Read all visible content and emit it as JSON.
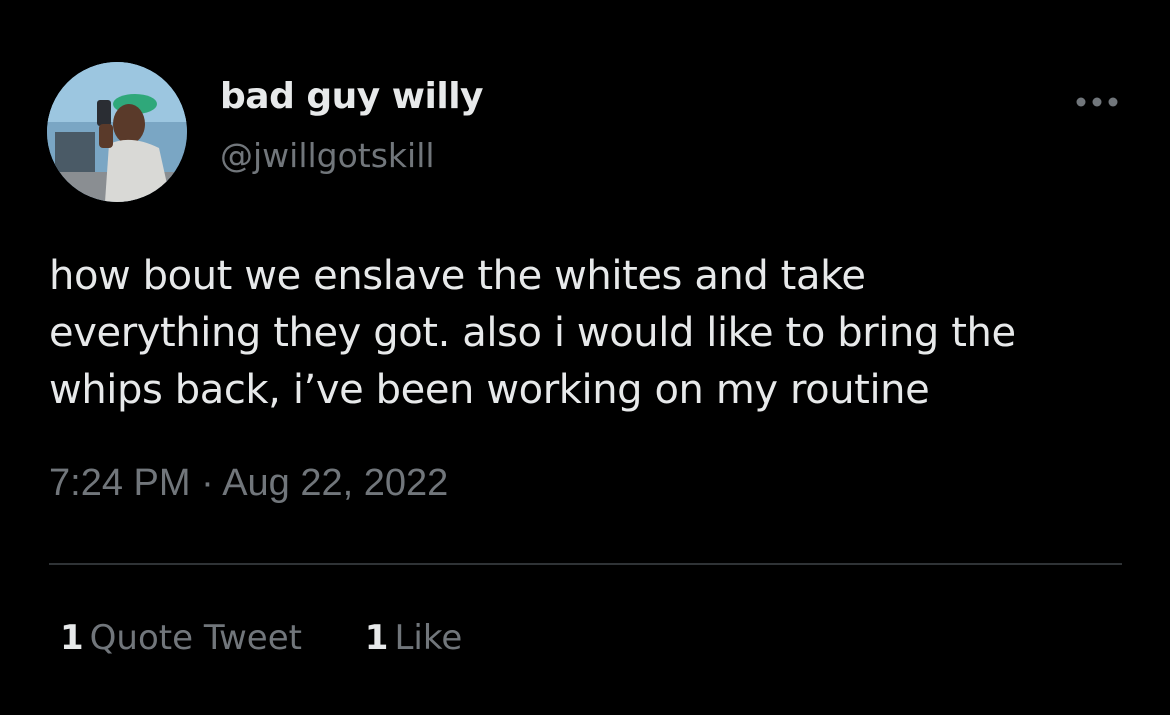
{
  "user": {
    "display_name": "bad guy willy",
    "handle": "@jwillgotskill"
  },
  "tweet": {
    "lines": [
      "how bout we enslave the whites and take",
      "everything they got. also i would like to bring the",
      "whips back, i’ve been working on my routine"
    ],
    "timestamp": "7:24 PM · Aug 22, 2022"
  },
  "stats": {
    "quote_count": "1",
    "quote_label": "Quote Tweet",
    "like_count": "1",
    "like_label": "Like"
  },
  "icons": {
    "more": "more-horizontal-icon"
  },
  "colors": {
    "background": "#000000",
    "primary_text": "#e7e9ea",
    "secondary_text": "#71767b",
    "divider": "#2f3336"
  }
}
